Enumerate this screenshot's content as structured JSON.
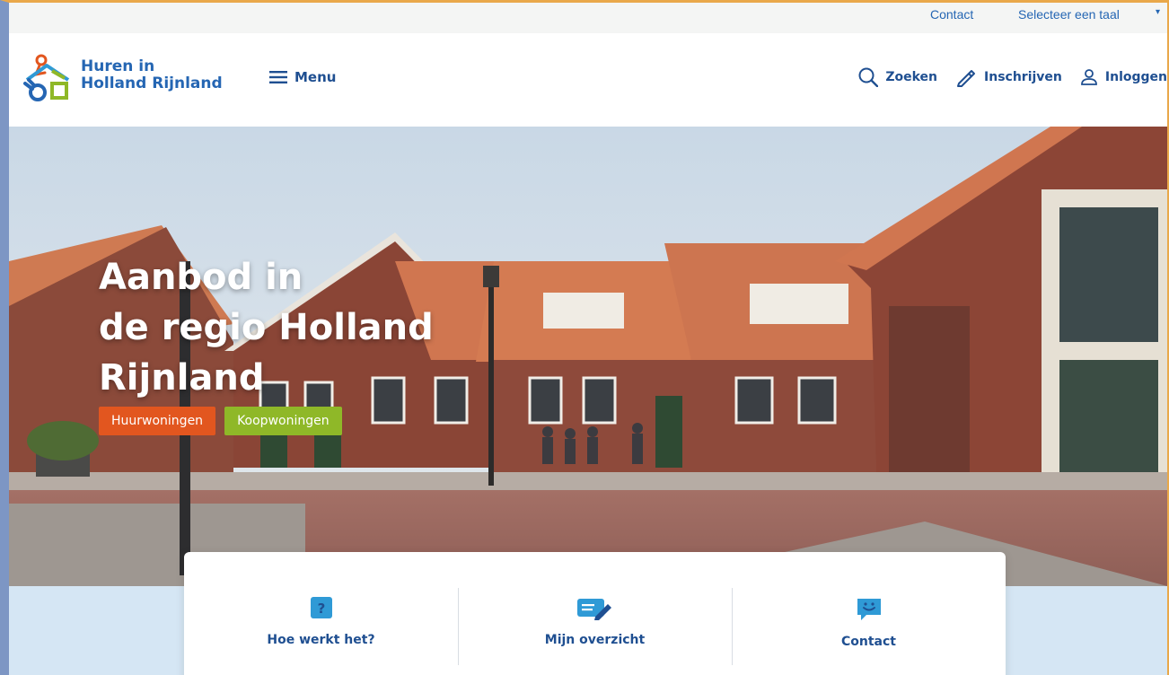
{
  "utility": {
    "contact": "Contact",
    "language": "Selecteer een taal"
  },
  "logo": {
    "line1": "Huren in",
    "line2": "Holland Rijnland"
  },
  "nav": {
    "menu": "Menu",
    "search": "Zoeken",
    "register": "Inschrijven",
    "login": "Inloggen"
  },
  "hero": {
    "title_line1": "Aanbod in",
    "title_line2": "de regio Holland",
    "title_line3": "Rijnland",
    "btn_rent": "Huurwoningen",
    "btn_buy": "Koopwoningen"
  },
  "quick": [
    {
      "label": "Hoe werkt het?",
      "icon": "question-icon"
    },
    {
      "label": "Mijn overzicht",
      "icon": "edit-note-icon"
    },
    {
      "label": "Contact",
      "icon": "chat-smile-icon"
    }
  ],
  "colors": {
    "brand_blue": "#2566b3",
    "nav_blue": "#1f4f91",
    "rent_orange": "#e2561f",
    "buy_green": "#8fb828",
    "light_band": "#d5e6f4"
  }
}
